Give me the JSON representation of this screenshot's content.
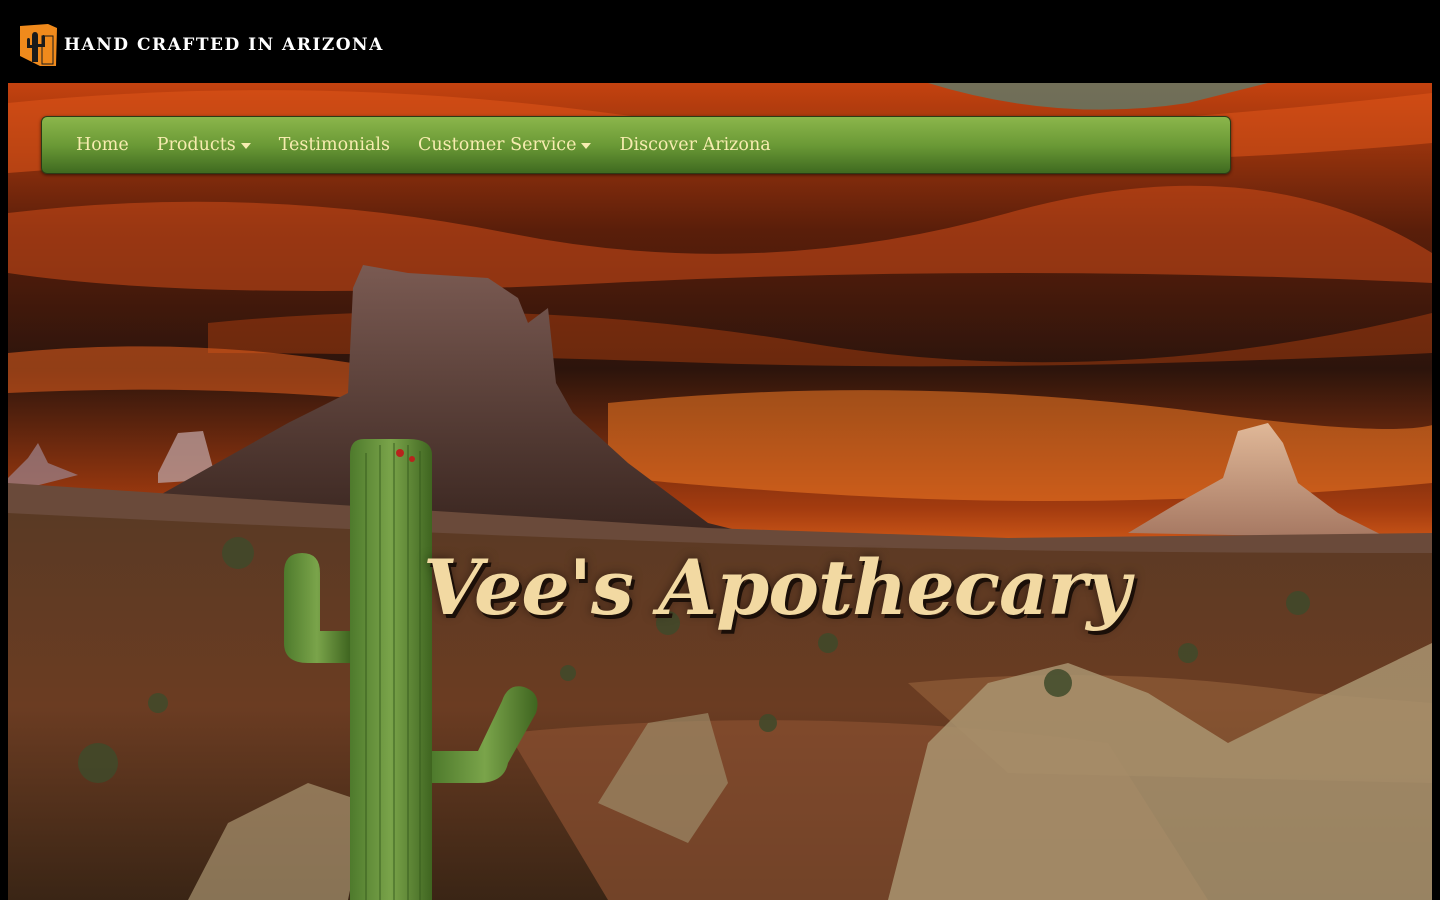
{
  "header": {
    "logo_icon": "arizona-state-cactus-logo",
    "tagline": "HAND CRAFTED IN ARIZONA"
  },
  "nav": {
    "items": [
      {
        "label": "Home",
        "has_dropdown": false
      },
      {
        "label": "Products",
        "has_dropdown": true
      },
      {
        "label": "Testimonials",
        "has_dropdown": false
      },
      {
        "label": "Customer Service",
        "has_dropdown": true
      },
      {
        "label": "Discover Arizona",
        "has_dropdown": false
      }
    ]
  },
  "hero": {
    "title": "Vee's Apothecary",
    "background": "desert-monument-valley-sunset"
  },
  "colors": {
    "nav_gradient_top": "#8bb64b",
    "nav_gradient_bottom": "#3f6a20",
    "nav_text": "#f7ecb0",
    "title_text": "#f2d9a2",
    "logo_orange": "#f08a1c"
  }
}
